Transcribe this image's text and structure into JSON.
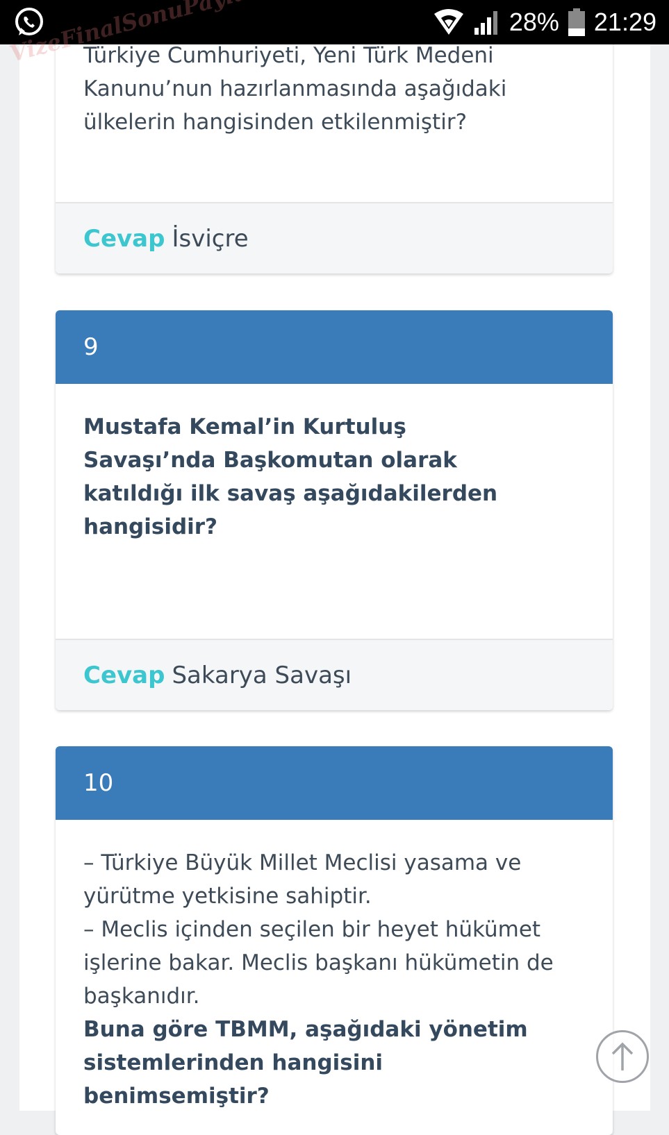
{
  "status_bar": {
    "battery": "28%",
    "time": "21:29"
  },
  "watermark": "VizeFinalSonuPaylasimi.com",
  "cards": [
    {
      "question": "Türkiye Cumhuriyeti, Yeni Türk Medeni Kanunu’nun hazırlanmasında aşağıdaki ülkelerin hangisinden etkilenmiştir?",
      "answer_label": "Cevap",
      "answer": "İsviçre"
    },
    {
      "number": "9",
      "question": "Mustafa Kemal’in Kurtuluş Savaşı’nda Başkomutan olarak katıldığı ilk savaş aşağıdakilerden hangisidir?",
      "answer_label": "Cevap",
      "answer": "Sakarya Savaşı"
    },
    {
      "number": "10",
      "lines": [
        "– Türkiye Büyük Millet Meclisi yasama ve yürütme yetkisine sahiptir.",
        "– Meclis içinden seçilen bir heyet hükümet işlerine bakar. Meclis başkanı hükümetin de başkanıdır."
      ],
      "question": "Buna göre TBMM, aşağıdaki yönetim sistemlerinden hangisini benimsemiştir?"
    }
  ],
  "icons": {
    "whatsapp": "whatsapp-icon",
    "wifi": "wifi-icon",
    "signal": "signal-icon",
    "battery": "battery-icon",
    "scroll_top": "arrow-up-icon"
  }
}
